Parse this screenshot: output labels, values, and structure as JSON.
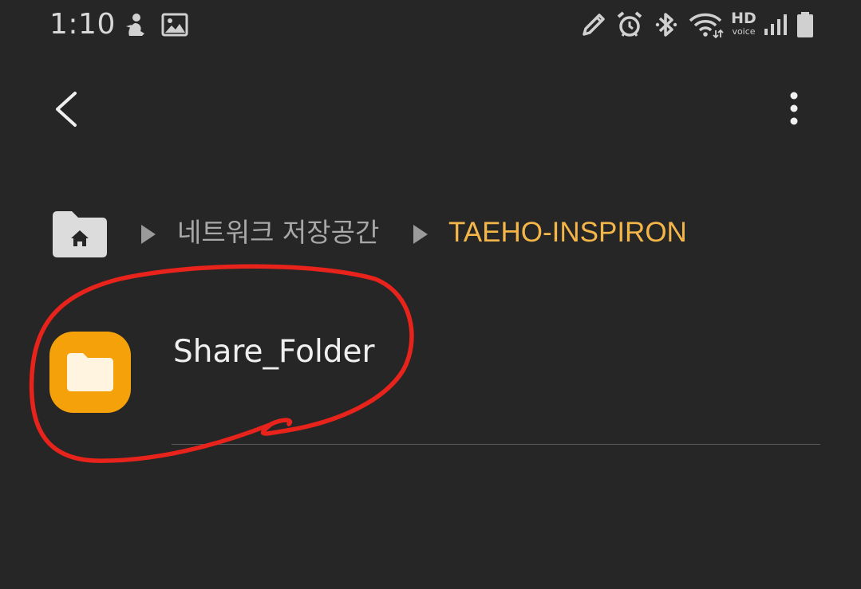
{
  "status_bar": {
    "time": "1:10",
    "hd_label": "HD",
    "voice_label": "voice",
    "icons": [
      "person-notification-icon",
      "image-notification-icon",
      "edit-icon",
      "alarm-icon",
      "bluetooth-icon",
      "wifi-icon",
      "hd-voice-icon",
      "signal-icon",
      "battery-icon"
    ]
  },
  "app_bar": {
    "back_icon": "chevron-left-icon",
    "more_icon": "more-vertical-icon"
  },
  "breadcrumb": {
    "home_icon": "home-folder-icon",
    "items": [
      {
        "label": "네트워크 저장공간"
      },
      {
        "label": "TAEHO-INSPIRON"
      }
    ],
    "current_color": "#f4b649"
  },
  "files": [
    {
      "name": "Share_Folder",
      "icon": "folder-icon",
      "icon_color": "#f5a20a"
    }
  ],
  "annotation": {
    "color": "#e8231c",
    "shape": "hand-drawn circle around Share_Folder"
  }
}
